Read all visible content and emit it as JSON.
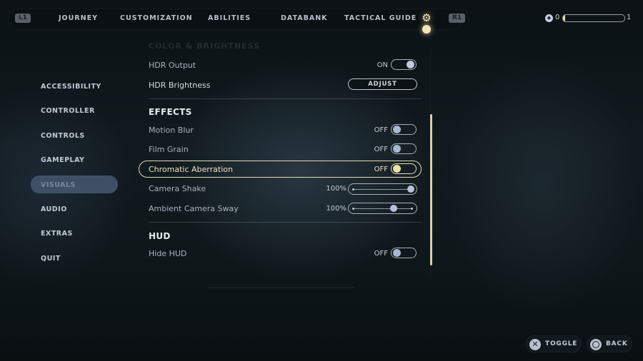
{
  "top_nav": {
    "left_button": "L1",
    "right_button": "R1",
    "tabs": [
      {
        "label": "JOURNEY"
      },
      {
        "label": "CUSTOMIZATION"
      },
      {
        "label": "ABILITIES"
      },
      {
        "label": "DATABANK"
      },
      {
        "label": "TACTICAL GUIDE"
      }
    ],
    "active_tab_icon": "gear-icon",
    "xp": {
      "current": "0",
      "next": "1",
      "progress_percent": 3
    }
  },
  "sidebar": {
    "items": [
      {
        "label": "ACCESSIBILITY"
      },
      {
        "label": "CONTROLLER"
      },
      {
        "label": "CONTROLS"
      },
      {
        "label": "GAMEPLAY"
      },
      {
        "label": "VISUALS",
        "active": true
      },
      {
        "label": "AUDIO"
      },
      {
        "label": "EXTRAS"
      },
      {
        "label": "QUIT"
      }
    ]
  },
  "settings": {
    "faded_section": "COLOR & BRIGHTNESS",
    "hdr_output": {
      "label": "HDR Output",
      "state": "ON"
    },
    "hdr_brightness": {
      "label": "HDR Brightness",
      "button": "ADJUST"
    },
    "effects_title": "EFFECTS",
    "motion_blur": {
      "label": "Motion Blur",
      "state": "OFF"
    },
    "film_grain": {
      "label": "Film Grain",
      "state": "OFF"
    },
    "chromatic_aberration": {
      "label": "Chromatic Aberration",
      "state": "OFF"
    },
    "camera_shake": {
      "label": "Camera Shake",
      "value": "100%",
      "slider_fraction": 1.0
    },
    "ambient_camera_sway": {
      "label": "Ambient Camera Sway",
      "value": "100%",
      "slider_fraction": 0.7
    },
    "hud_title": "HUD",
    "hide_hud": {
      "label": "Hide HUD",
      "state": "OFF"
    }
  },
  "prompts": {
    "toggle": {
      "label": "TOGGLE",
      "icon": "cross-button-icon"
    },
    "back": {
      "label": "BACK",
      "icon": "circle-button-icon"
    }
  },
  "colors": {
    "accent": "#e3dab2",
    "active_sidebar": "#3f5066"
  }
}
